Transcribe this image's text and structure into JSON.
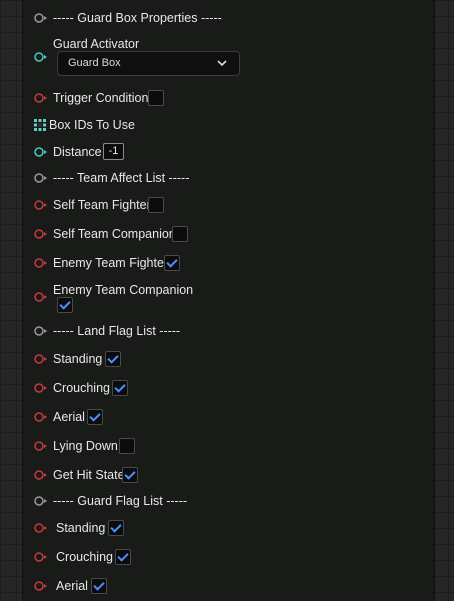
{
  "colors": {
    "pin_red": "#c93a3a",
    "pin_gray": "#9a9a9a",
    "pin_teal": "#3ecfc0",
    "grid_pin": "#5fcfbf",
    "check_blue": "#4a90ff"
  },
  "rows": {
    "guard_box_header": "----- Guard Box Properties -----",
    "guard_activator": "Guard Activator",
    "guard_activator_value": "Guard Box",
    "trigger_condition": "Trigger Condition",
    "box_ids": "Box IDs To Use",
    "distance": "Distance",
    "distance_value": "-1",
    "team_header": "----- Team Affect List -----",
    "self_team_fighter": "Self Team Fighter",
    "self_team_companion": "Self Team Companion",
    "enemy_team_fighter": "Enemy Team Fighter",
    "enemy_team_companion": "Enemy Team Companion",
    "land_header": "----- Land Flag List -----",
    "land_standing": "Standing",
    "land_crouching": "Crouching",
    "land_aerial": "Aerial",
    "land_lying_down": "Lying Down",
    "land_get_hit_state": "Get Hit State",
    "guard_header": "----- Guard Flag List -----",
    "guard_standing": "Standing",
    "guard_crouching": "Crouching",
    "guard_aerial": "Aerial"
  },
  "checked": {
    "trigger_condition": false,
    "self_team_fighter": false,
    "self_team_companion": false,
    "enemy_team_fighter": true,
    "enemy_team_companion": true,
    "land_standing": true,
    "land_crouching": true,
    "land_aerial": true,
    "land_lying_down": false,
    "land_get_hit_state": true,
    "guard_standing": true,
    "guard_crouching": true,
    "guard_aerial": true
  }
}
